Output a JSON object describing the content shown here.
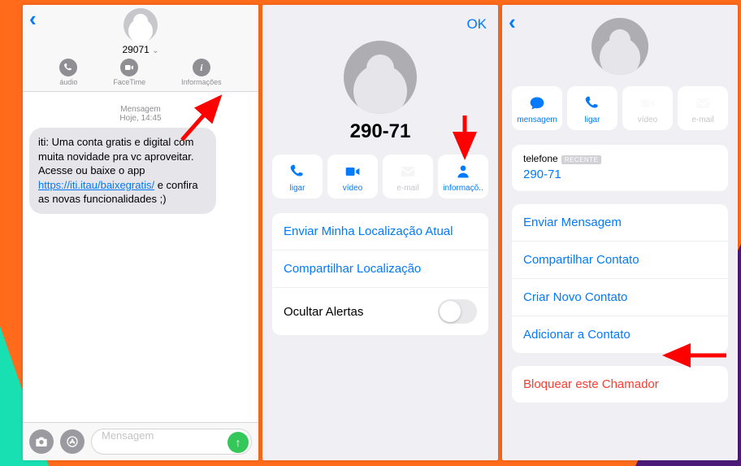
{
  "screen1": {
    "sender": "29071",
    "actions": {
      "audio": "áudio",
      "facetime": "FaceTime",
      "info": "Informações"
    },
    "meta_label": "Mensagem",
    "meta_time": "Hoje, 14:45",
    "message": {
      "part1": "iti: Uma conta gratis e digital com muita novidade pra vc aproveitar. Acesse ou baixe o app ",
      "link": "https://iti.itau/baixegratis/",
      "part2": " e confira as novas funcionalidades ;)"
    },
    "input_placeholder": "Mensagem"
  },
  "screen2": {
    "ok": "OK",
    "name": "290-71",
    "actions": {
      "call": "ligar",
      "video": "vídeo",
      "mail": "e-mail",
      "info": "informaçõ.."
    },
    "rows": {
      "send_location": "Enviar Minha Localização Atual",
      "share_location": "Compartilhar Localização",
      "hide_alerts": "Ocultar Alertas"
    }
  },
  "screen3": {
    "actions": {
      "message": "mensagem",
      "call": "ligar",
      "video": "vídeo",
      "mail": "e-mail"
    },
    "phone_label": "telefone",
    "phone_badge": "RECENTE",
    "phone_number": "290-71",
    "rows": {
      "send_message": "Enviar Mensagem",
      "share_contact": "Compartilhar Contato",
      "create_contact": "Criar Novo Contato",
      "add_contact": "Adicionar a Contato",
      "block": "Bloquear este Chamador"
    }
  }
}
